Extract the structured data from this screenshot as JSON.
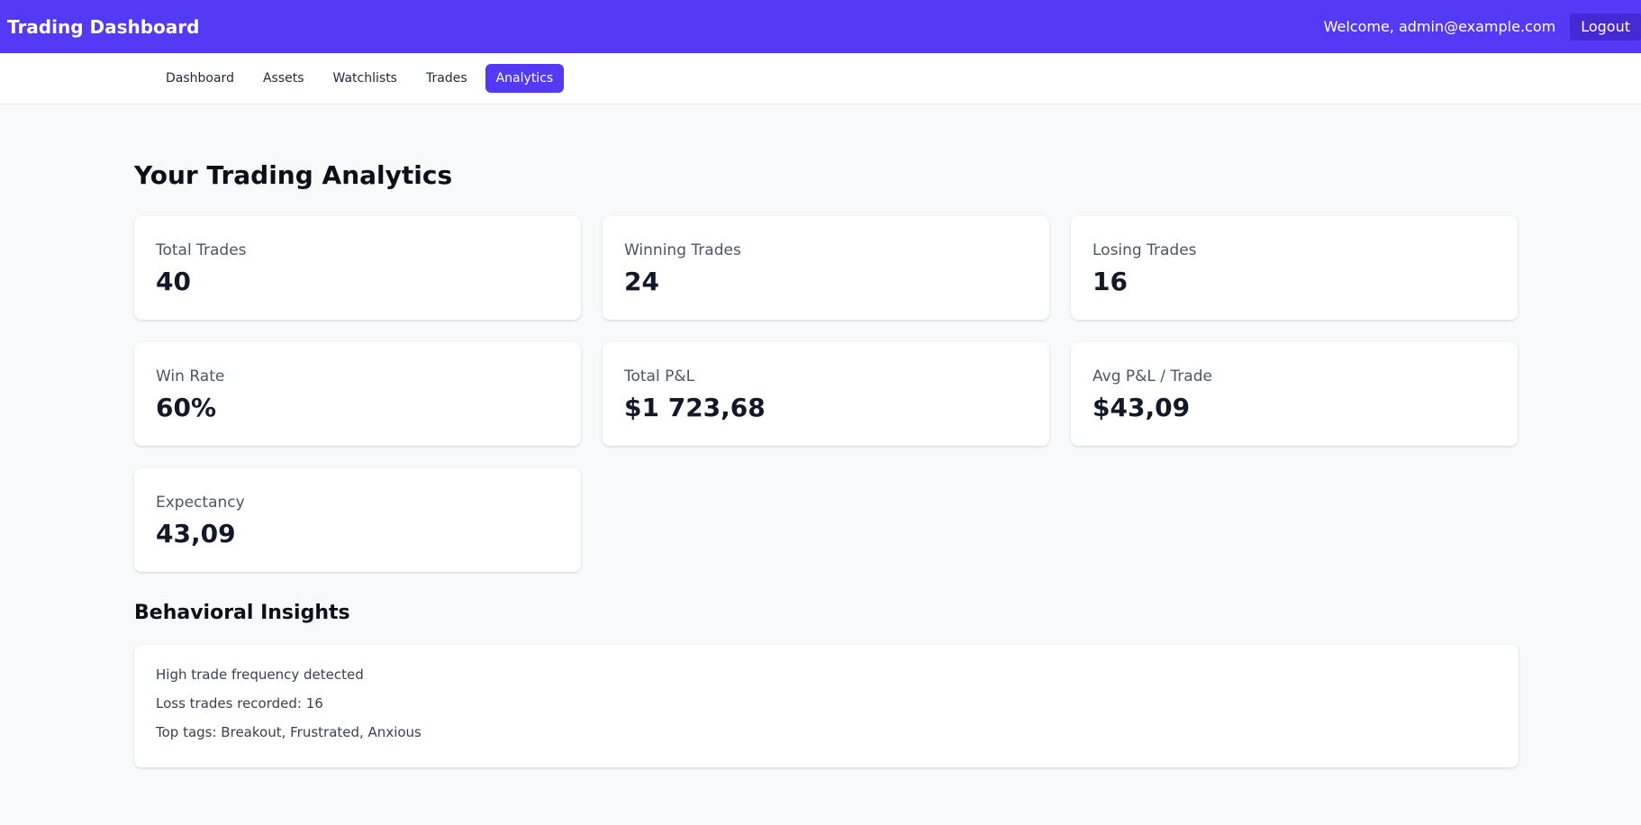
{
  "header": {
    "brand": "Trading Dashboard",
    "welcome": "Welcome, admin@example.com",
    "logout_label": "Logout"
  },
  "nav": {
    "items": [
      {
        "label": "Dashboard"
      },
      {
        "label": "Assets"
      },
      {
        "label": "Watchlists"
      },
      {
        "label": "Trades"
      },
      {
        "label": "Analytics",
        "active": true
      }
    ]
  },
  "main": {
    "title": "Your Trading Analytics",
    "stats": [
      {
        "label": "Total Trades",
        "value": "40"
      },
      {
        "label": "Winning Trades",
        "value": "24"
      },
      {
        "label": "Losing Trades",
        "value": "16"
      },
      {
        "label": "Win Rate",
        "value": "60%"
      },
      {
        "label": "Total P&L",
        "value": "$1 723,68"
      },
      {
        "label": "Avg P&L / Trade",
        "value": "$43,09"
      },
      {
        "label": "Expectancy",
        "value": "43,09"
      }
    ],
    "insights_title": "Behavioral Insights",
    "insights": [
      "High trade frequency detected",
      "Loss trades recorded: 16",
      "Top tags: Breakout, Frustrated, Anxious"
    ]
  },
  "colors": {
    "header_bg": "#5439f6",
    "active_nav_bg": "#5439f6",
    "logout_bg": "#4429d4",
    "page_bg": "#f8f9fa"
  }
}
